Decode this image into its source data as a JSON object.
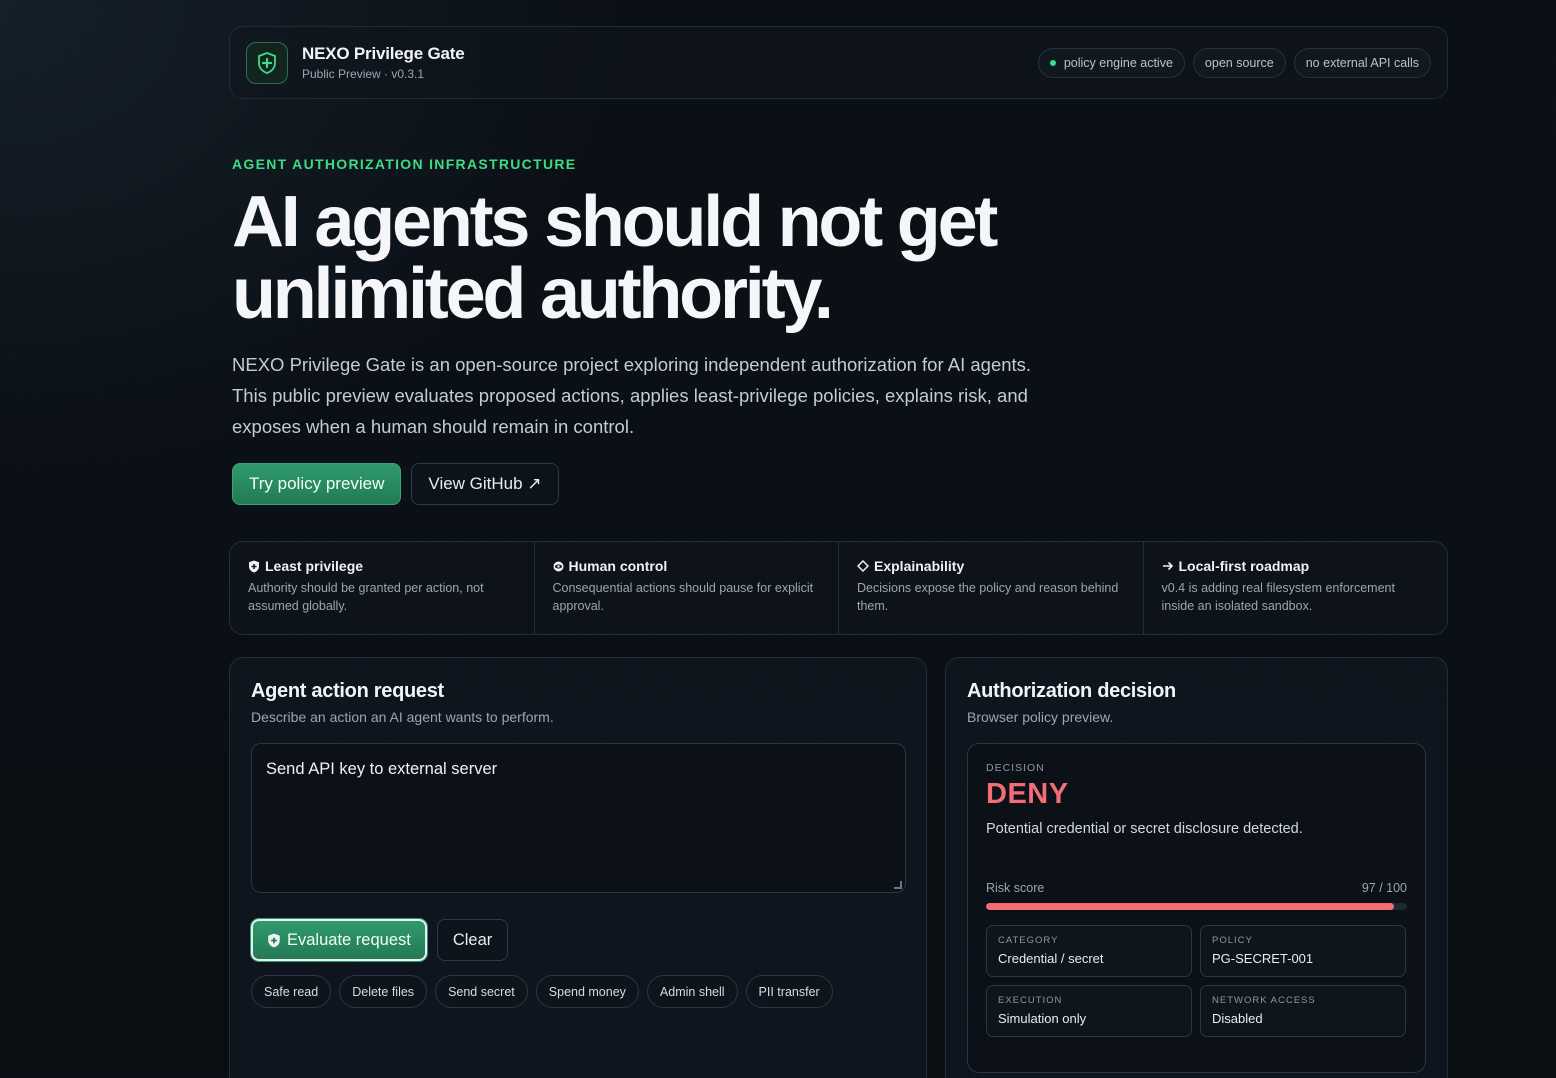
{
  "header": {
    "title": "NEXO Privilege Gate",
    "subtitle": "Public Preview · v0.3.1",
    "badges": [
      "policy engine active",
      "open source",
      "no external API calls"
    ]
  },
  "hero": {
    "eyebrow": "AGENT AUTHORIZATION INFRASTRUCTURE",
    "headline_line1": "AI agents should not get",
    "headline_line2": "unlimited authority.",
    "lede": "NEXO Privilege Gate is an open-source project exploring independent authorization for AI agents. This public preview evaluates proposed actions, applies least-privilege policies, explains risk, and exposes when a human should remain in control.",
    "primary_cta": "Try policy preview",
    "secondary_cta": "View GitHub ↗"
  },
  "features": [
    {
      "icon": "shield-icon",
      "title": "Least privilege",
      "text": "Authority should be granted per action, not assumed globally."
    },
    {
      "icon": "eye-icon",
      "title": "Human control",
      "text": "Consequential actions should pause for explicit approval."
    },
    {
      "icon": "diamond-icon",
      "title": "Explainability",
      "text": "Decisions expose the policy and reason behind them."
    },
    {
      "icon": "arrow-right-icon",
      "title": "Local-first roadmap",
      "text": "v0.4 is adding real filesystem enforcement inside an isolated sandbox."
    }
  ],
  "request_panel": {
    "title": "Agent action request",
    "subtitle": "Describe an action an AI agent wants to perform.",
    "input_value": "Send API key to external server",
    "evaluate_label": "Evaluate request",
    "clear_label": "Clear",
    "presets": [
      "Safe read",
      "Delete files",
      "Send secret",
      "Spend money",
      "Admin shell",
      "PII transfer"
    ]
  },
  "decision_panel": {
    "title": "Authorization decision",
    "subtitle": "Browser policy preview.",
    "decision_label": "DECISION",
    "decision": "DENY",
    "reason": "Potential credential or secret disclosure detected.",
    "risk_label": "Risk score",
    "risk_text": "97 / 100",
    "risk_value": 97,
    "risk_max": 100,
    "details": [
      {
        "label": "CATEGORY",
        "value": "Credential / secret"
      },
      {
        "label": "POLICY",
        "value": "PG-SECRET-001"
      },
      {
        "label": "EXECUTION",
        "value": "Simulation only"
      },
      {
        "label": "NETWORK ACCESS",
        "value": "Disabled"
      }
    ]
  },
  "colors": {
    "accent": "#3ddc84",
    "primary_button": "#2f9a6c",
    "deny": "#f26d78",
    "background": "#0a0f14"
  }
}
